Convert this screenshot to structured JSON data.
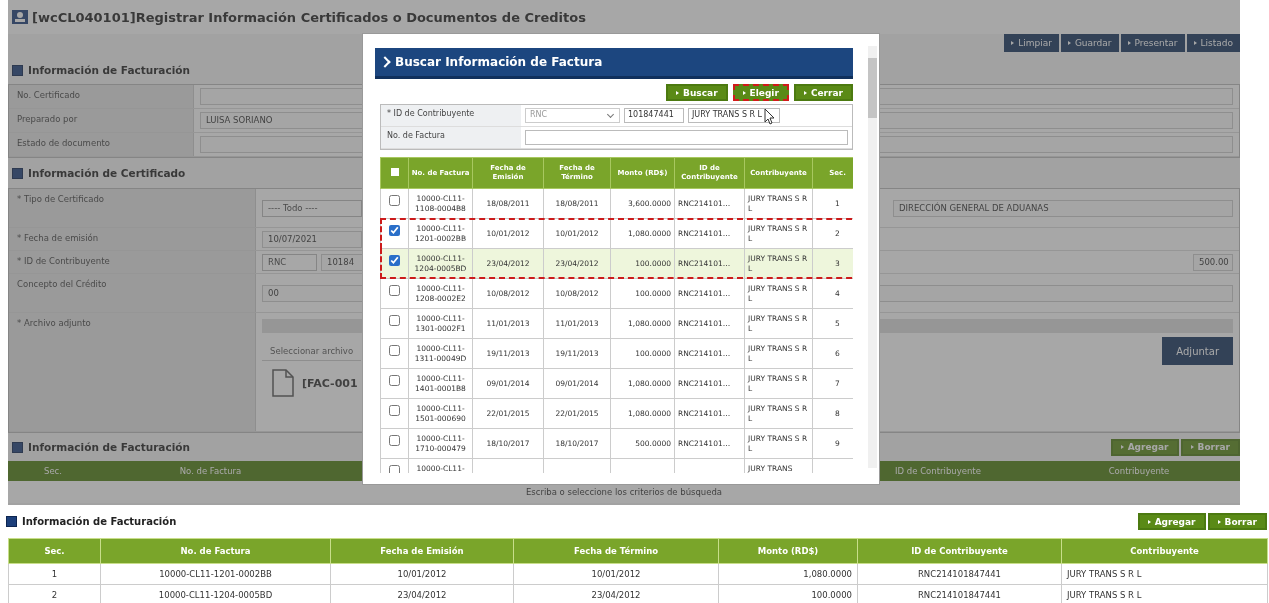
{
  "window": {
    "title": "[wcCL040101]Registrar Información Certificados o Documentos de Creditos"
  },
  "toolbar": [
    "Limpiar",
    "Guardar",
    "Presentar",
    "Listado"
  ],
  "billing_info": {
    "title": "Información de Facturación",
    "rows": [
      {
        "label": "No. Certificado",
        "value": ""
      },
      {
        "label": "Preparado por",
        "value": "LUISA SORIANO"
      },
      {
        "label": "Estado de documento",
        "value": ""
      }
    ]
  },
  "certificate_info": {
    "title": "Información de Certificado",
    "type": {
      "label": "* Tipo de Certificado",
      "value": "---- Todo ----",
      "issuer": "DIRECCIÓN GENERAL DE ADUANAS"
    },
    "date": {
      "label": "* Fecha de emisión",
      "value": "10/07/2021"
    },
    "taxpayer": {
      "label": "* ID de Contribuyente",
      "id_type": "RNC",
      "id": "10184",
      "amount": "500.00"
    },
    "concept": {
      "label": "Concepto del Crédito",
      "value": "00"
    },
    "attachment": {
      "label": "* Archivo adjunto",
      "placeholder": "Seleccionar archivo",
      "file": "[FAC-001",
      "button": "Adjuntar"
    }
  },
  "background_billing": {
    "title": "Información de Facturación",
    "buttons": [
      "Agregar",
      "Borrar"
    ],
    "columns": [
      "Sec.",
      "No. de Factura",
      "",
      "",
      "",
      "ID de Contribuyente",
      "Contribuyente"
    ],
    "message": "Escriba o seleccione los criterios de búsqueda"
  },
  "dialog": {
    "title": "Buscar Información de Factura",
    "buttons": [
      {
        "label": "Buscar",
        "outlined": false
      },
      {
        "label": "Elegir",
        "outlined": true
      },
      {
        "label": "Cerrar",
        "outlined": false
      }
    ],
    "search": {
      "id_label": "* ID de Contribuyente",
      "id_type": "RNC",
      "id_value": "101847441",
      "name_value": "JURY TRANS S R L",
      "invoice_label": "No. de Factura"
    },
    "select_all": {
      "checked": false
    },
    "columns": [
      "No. de Factura",
      "Fecha de Emisión",
      "Fecha de Término",
      "Monto (RD$)",
      "ID de Contribuyente",
      "Contribuyente",
      "Sec."
    ],
    "rows": [
      {
        "checked": false,
        "highlighted": false,
        "outlined": false,
        "invoice": "10000-CL11-1108-0004B8",
        "issued": "18/08/2011",
        "due": "18/08/2011",
        "amount": "3,600.0000",
        "taxpayer_id": "RNC214101…",
        "taxpayer": "JURY TRANS S R L",
        "seq": "1"
      },
      {
        "checked": true,
        "highlighted": false,
        "outlined": true,
        "invoice": "10000-CL11-1201-0002BB",
        "issued": "10/01/2012",
        "due": "10/01/2012",
        "amount": "1,080.0000",
        "taxpayer_id": "RNC214101…",
        "taxpayer": "JURY TRANS S R L",
        "seq": "2"
      },
      {
        "checked": true,
        "highlighted": true,
        "outlined": true,
        "invoice": "10000-CL11-1204-0005BD",
        "issued": "23/04/2012",
        "due": "23/04/2012",
        "amount": "100.0000",
        "taxpayer_id": "RNC214101…",
        "taxpayer": "JURY TRANS S R L",
        "seq": "3"
      },
      {
        "checked": false,
        "highlighted": false,
        "outlined": false,
        "invoice": "10000-CL11-1208-0002E2",
        "issued": "10/08/2012",
        "due": "10/08/2012",
        "amount": "100.0000",
        "taxpayer_id": "RNC214101…",
        "taxpayer": "JURY TRANS S R L",
        "seq": "4"
      },
      {
        "checked": false,
        "highlighted": false,
        "outlined": false,
        "invoice": "10000-CL11-1301-0002F1",
        "issued": "11/01/2013",
        "due": "11/01/2013",
        "amount": "1,080.0000",
        "taxpayer_id": "RNC214101…",
        "taxpayer": "JURY TRANS S R L",
        "seq": "5"
      },
      {
        "checked": false,
        "highlighted": false,
        "outlined": false,
        "invoice": "10000-CL11-1311-00049D",
        "issued": "19/11/2013",
        "due": "19/11/2013",
        "amount": "100.0000",
        "taxpayer_id": "RNC214101…",
        "taxpayer": "JURY TRANS S R L",
        "seq": "6"
      },
      {
        "checked": false,
        "highlighted": false,
        "outlined": false,
        "invoice": "10000-CL11-1401-0001B8",
        "issued": "09/01/2014",
        "due": "09/01/2014",
        "amount": "1,080.0000",
        "taxpayer_id": "RNC214101…",
        "taxpayer": "JURY TRANS S R L",
        "seq": "7"
      },
      {
        "checked": false,
        "highlighted": false,
        "outlined": false,
        "invoice": "10000-CL11-1501-000690",
        "issued": "22/01/2015",
        "due": "22/01/2015",
        "amount": "1,080.0000",
        "taxpayer_id": "RNC214101…",
        "taxpayer": "JURY TRANS S R L",
        "seq": "8"
      },
      {
        "checked": false,
        "highlighted": false,
        "outlined": false,
        "invoice": "10000-CL11-1710-000479",
        "issued": "18/10/2017",
        "due": "18/10/2017",
        "amount": "500.0000",
        "taxpayer_id": "RNC214101…",
        "taxpayer": "JURY TRANS S R L",
        "seq": "9"
      },
      {
        "checked": false,
        "highlighted": false,
        "outlined": false,
        "invoice": "10000-CL11-",
        "issued": "",
        "due": "",
        "amount": "",
        "taxpayer_id": "",
        "taxpayer": "JURY TRANS",
        "seq": ""
      }
    ]
  },
  "billing": {
    "title": "Información de Facturación",
    "buttons": [
      "Agregar",
      "Borrar"
    ],
    "columns": [
      "Sec.",
      "No. de Factura",
      "Fecha de Emisión",
      "Fecha de Término",
      "Monto (RD$)",
      "ID de Contribuyente",
      "Contribuyente"
    ],
    "rows": [
      {
        "seq": "1",
        "invoice": "10000-CL11-1201-0002BB",
        "issued": "10/01/2012",
        "due": "10/01/2012",
        "amount": "1,080.0000",
        "taxpayer_id": "RNC214101847441",
        "taxpayer": "JURY TRANS S R L"
      },
      {
        "seq": "2",
        "invoice": "10000-CL11-1204-0005BD",
        "issued": "23/04/2012",
        "due": "23/04/2012",
        "amount": "100.0000",
        "taxpayer_id": "RNC214101847441",
        "taxpayer": "JURY TRANS S R L"
      }
    ]
  }
}
